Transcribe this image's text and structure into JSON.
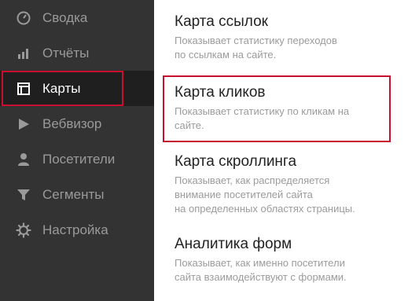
{
  "sidebar": {
    "items": [
      {
        "label": "Сводка",
        "icon": "speedometer-icon"
      },
      {
        "label": "Отчёты",
        "icon": "bar-chart-icon"
      },
      {
        "label": "Карты",
        "icon": "layout-icon",
        "active": true
      },
      {
        "label": "Вебвизор",
        "icon": "play-icon"
      },
      {
        "label": "Посетители",
        "icon": "person-icon"
      },
      {
        "label": "Сегменты",
        "icon": "funnel-icon"
      },
      {
        "label": "Настройка",
        "icon": "gear-icon"
      }
    ]
  },
  "main": {
    "entries": [
      {
        "title": "Карта ссылок",
        "desc_lines": [
          "Показывает статистику переходов",
          "по ссылкам на сайте."
        ]
      },
      {
        "title": "Карта кликов",
        "desc_lines": [
          "Показывает статистику по кликам на",
          "сайте."
        ],
        "highlighted": true
      },
      {
        "title": "Карта скроллинга",
        "desc_lines": [
          "Показывает, как распределяется",
          "внимание посетителей сайта",
          "на определенных областях страницы."
        ]
      },
      {
        "title": "Аналитика форм",
        "desc_lines": [
          "Показывает, как именно посетители",
          "сайта взаимодействуют с формами."
        ]
      }
    ]
  },
  "colors": {
    "sidebar_bg": "#333333",
    "highlight": "#c8102e",
    "muted_text": "#9b9b9b"
  }
}
